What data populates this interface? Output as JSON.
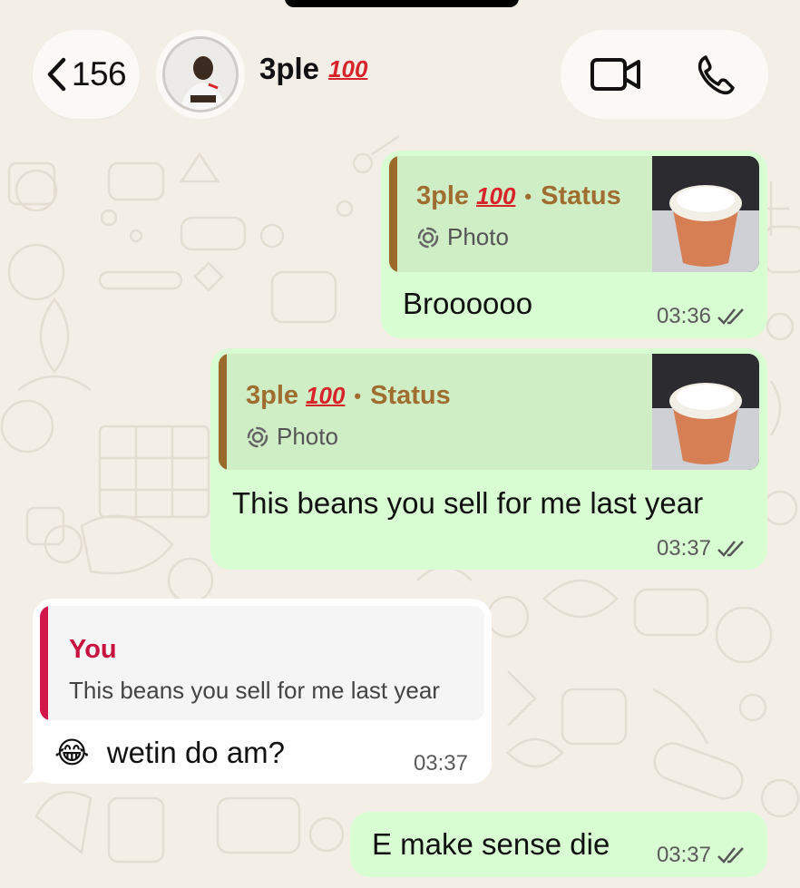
{
  "header": {
    "back_count": "156",
    "contact_name": "3ple",
    "contact_emoji": "100"
  },
  "messages": [
    {
      "direction": "outgoing",
      "quote": {
        "author": "3ple",
        "author_emoji": "100",
        "source": "Status",
        "type": "Photo"
      },
      "text": "Broooooo",
      "time": "03:36",
      "status": "read"
    },
    {
      "direction": "outgoing",
      "quote": {
        "author": "3ple",
        "author_emoji": "100",
        "source": "Status",
        "type": "Photo"
      },
      "text": "This beans you sell for me last year",
      "time": "03:37",
      "status": "read"
    },
    {
      "direction": "incoming",
      "quote": {
        "author": "You",
        "text": "This beans you sell for me last year"
      },
      "emoji": "😂",
      "text": "wetin do am?",
      "time": "03:37"
    },
    {
      "direction": "outgoing",
      "text": "E make sense die",
      "time": "03:37",
      "status": "read"
    }
  ],
  "colors": {
    "outgoing_bubble": "#d9fdd3",
    "incoming_bubble": "#ffffff",
    "status_quote_accent": "#9a6a2b",
    "you_quote_accent": "#d4174b"
  },
  "icons": [
    "back-chevron-icon",
    "video-call-icon",
    "phone-call-icon",
    "status-ring-icon",
    "double-check-icon"
  ]
}
